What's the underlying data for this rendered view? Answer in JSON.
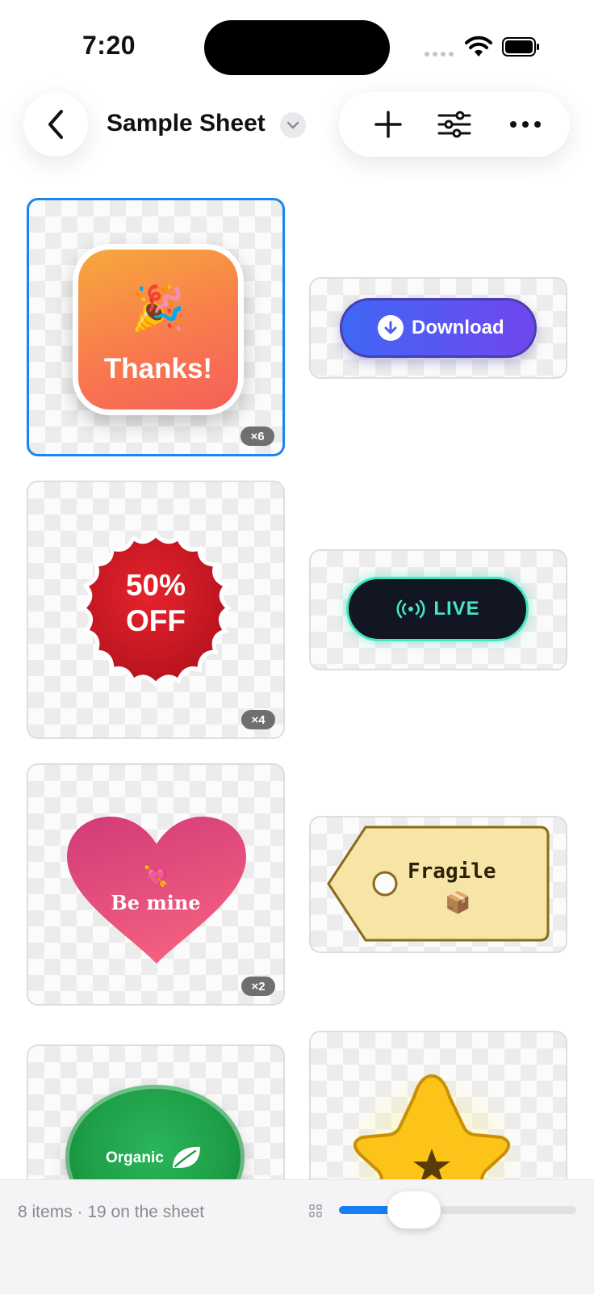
{
  "status_bar": {
    "time": "7:20"
  },
  "toolbar": {
    "title": "Sample Sheet",
    "actions": [
      "add-icon",
      "sliders-icon",
      "more-icon"
    ]
  },
  "stickers": [
    {
      "name": "Thanks!",
      "emoji": "🎉",
      "count": "×6",
      "selected": true
    },
    {
      "name": "Download",
      "icon": "arrow-down-circle-icon"
    },
    {
      "name": "50% OFF",
      "line1": "50%",
      "line2": "OFF",
      "count": "×4"
    },
    {
      "name": "LIVE",
      "icon": "broadcast-icon"
    },
    {
      "name": "Be mine",
      "emoji": "💘",
      "count": "×2"
    },
    {
      "name": "Fragile",
      "emoji": "📦"
    },
    {
      "name": "Organic",
      "icon": "leaf-icon"
    },
    {
      "name": "Star",
      "icon": "star-icon"
    }
  ],
  "footer": {
    "summary": "8 items · 19 on the sheet",
    "size_slider_fraction": 0.17
  },
  "colors": {
    "accent": "#1a86f0",
    "download_start": "#3f67f5",
    "download_end": "#7146ee",
    "sale_red": "#d41b25",
    "live_teal": "#47e4c6",
    "heart_pink": "#e0457a",
    "tag_yellow": "#f6e5a6",
    "organic_green": "#1d9e46",
    "star_yellow": "#fcc419"
  }
}
